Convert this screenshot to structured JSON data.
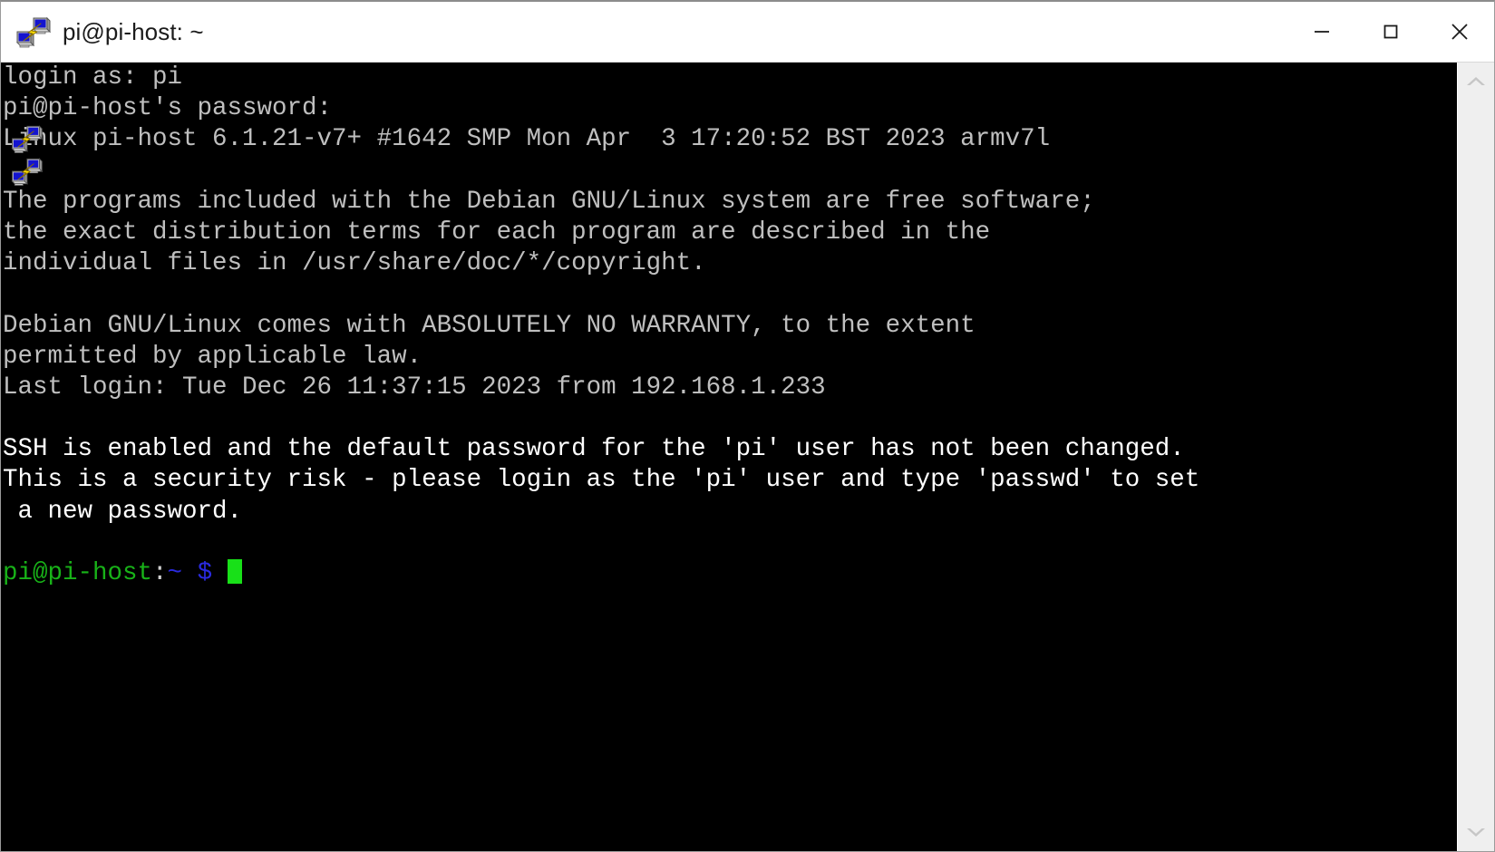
{
  "window": {
    "title": "pi@pi-host: ~",
    "app_icon": "putty-icon",
    "controls": {
      "minimize": "—",
      "maximize": "□",
      "close": "✕",
      "minimize_name": "minimize",
      "maximize_name": "maximize",
      "close_name": "close"
    }
  },
  "terminal": {
    "background": "#000000",
    "foreground": "#bfbfbf",
    "bold_color": "#ffffff",
    "prompt_user_color": "#18b218",
    "prompt_path_color": "#2a2ae0",
    "cursor_color": "#18e018",
    "lines": [
      {
        "id": "login-prompt",
        "text": "login as: pi",
        "style": "dim"
      },
      {
        "id": "password-prompt",
        "text": "pi@pi-host's password:",
        "style": "dim"
      },
      {
        "id": "uname-banner",
        "text": "Linux pi-host 6.1.21-v7+ #1642 SMP Mon Apr  3 17:20:52 BST 2023 armv7l",
        "style": "dim"
      },
      {
        "id": "blank-1",
        "text": "",
        "style": "dim"
      },
      {
        "id": "debian-notice-1",
        "text": "The programs included with the Debian GNU/Linux system are free software;",
        "style": "dim"
      },
      {
        "id": "debian-notice-2",
        "text": "the exact distribution terms for each program are described in the",
        "style": "dim"
      },
      {
        "id": "debian-notice-3",
        "text": "individual files in /usr/share/doc/*/copyright.",
        "style": "dim"
      },
      {
        "id": "blank-2",
        "text": "",
        "style": "dim"
      },
      {
        "id": "warranty-1",
        "text": "Debian GNU/Linux comes with ABSOLUTELY NO WARRANTY, to the extent",
        "style": "dim"
      },
      {
        "id": "warranty-2",
        "text": "permitted by applicable law.",
        "style": "dim"
      },
      {
        "id": "last-login",
        "text": "Last login: Tue Dec 26 11:37:15 2023 from 192.168.1.233",
        "style": "dim"
      },
      {
        "id": "blank-3",
        "text": "",
        "style": "dim"
      },
      {
        "id": "ssh-warning-1",
        "text": "SSH is enabled and the default password for the 'pi' user has not been changed.",
        "style": "bold"
      },
      {
        "id": "ssh-warning-2",
        "text": "This is a security risk - please login as the 'pi' user and type 'passwd' to set",
        "style": "bold"
      },
      {
        "id": "ssh-warning-3",
        "text": " a new password.",
        "style": "bold"
      },
      {
        "id": "blank-4",
        "text": "",
        "style": "dim"
      }
    ],
    "prompt": {
      "user_host": "pi@pi-host",
      "separator": ":",
      "path": "~",
      "sigil": "$",
      "command": ""
    },
    "overlay_icons": [
      {
        "id": "overlay-icon-1",
        "name": "putty-icon"
      },
      {
        "id": "overlay-icon-2",
        "name": "putty-icon"
      }
    ]
  },
  "scrollbar": {
    "up_arrow": "scroll-up-arrow-icon",
    "down_arrow": "scroll-down-arrow-icon"
  }
}
